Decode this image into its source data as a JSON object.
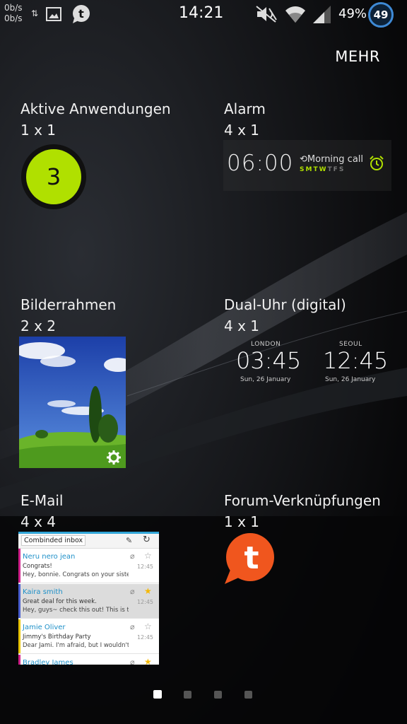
{
  "status_bar": {
    "netspeed_top": "0b/s",
    "netspeed_bottom": "0b/s",
    "clock": "14:21",
    "battery_percent": "49%",
    "badge": "49",
    "icons": [
      "data-arrows-icon",
      "gallery-icon",
      "tapatalk-icon",
      "mute-icon",
      "wifi-icon",
      "signal-icon"
    ]
  },
  "header": {
    "more_label": "MEHR"
  },
  "widgets": {
    "active_apps": {
      "title": "Aktive Anwendungen",
      "size": "1 x 1",
      "count": "3"
    },
    "alarm": {
      "title": "Alarm",
      "size": "4 x 1",
      "time": "06:00",
      "label": "Morning call",
      "days": [
        "S",
        "M",
        "T",
        "W",
        "T",
        "F",
        "S"
      ],
      "day_active": [
        true,
        true,
        true,
        true,
        false,
        false,
        false
      ]
    },
    "photo_frame": {
      "title": "Bilderrahmen",
      "size": "2 x 2"
    },
    "dual_clock": {
      "title": "Dual-Uhr (digital)",
      "size": "4 x 1",
      "city1": "LONDON",
      "time1": "03:45",
      "date1": "Sun, 26 January",
      "city2": "SEOUL",
      "time2": "12:45",
      "date2": "Sun, 26 January"
    },
    "email": {
      "title": "E-Mail",
      "size": "4 x 4",
      "inbox_label": "Combinded inbox",
      "rows": [
        {
          "from": "Neru nero jean",
          "subject": "Congrats!",
          "preview": "Hey, bonnie. Congrats on your sister...",
          "time": "12:45",
          "starred": false,
          "accent": "#d0208a"
        },
        {
          "from": "Kaira smith",
          "subject": "Great deal for this week.",
          "preview": "Hey, guys~ check this out! This is th...",
          "time": "12:45",
          "starred": true,
          "accent": "#4a5fd0"
        },
        {
          "from": "Jamie Oliver",
          "subject": "Jimmy's Birthday Party",
          "preview": "Dear Jami. I'm afraid, but I wouldn't ...",
          "time": "12:45",
          "starred": false,
          "accent": "#e8c400"
        },
        {
          "from": "Bradley James",
          "subject": "",
          "preview": "",
          "time": "",
          "starred": true,
          "accent": "#d0208a"
        }
      ]
    },
    "forum": {
      "title": "Forum-Verknüpfungen",
      "size": "1 x 1"
    }
  },
  "page_indicator": {
    "count": 4,
    "active": 0
  },
  "colors": {
    "accent_green": "#b0e000",
    "tapatalk_orange": "#f0561e",
    "mail_blue": "#32a6d8"
  }
}
